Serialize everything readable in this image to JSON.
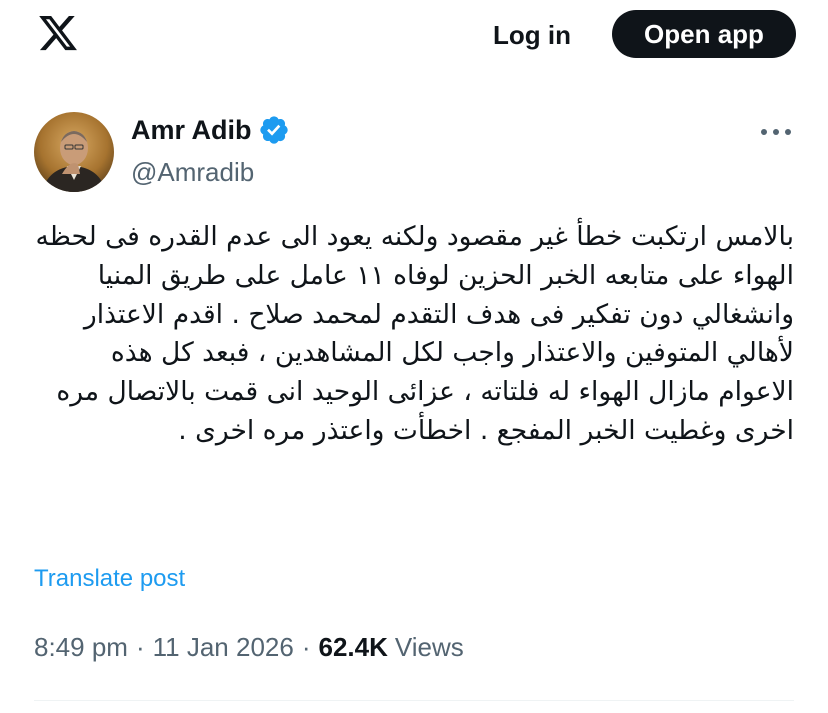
{
  "header": {
    "logo_icon": "x-logo-icon",
    "login_label": "Log in",
    "open_app_label": "Open app"
  },
  "author": {
    "name": "Amr Adib",
    "handle": "@Amradib",
    "verified": true,
    "verified_color": "#1d9bf0"
  },
  "post": {
    "text": "بالامس ارتكبت خطأ غير مقصود ولكنه يعود الى عدم القدره فى لحظه الهواء على متابعه الخبر الحزين لوفاه ١١ عامل على طريق المنيا وانشغالي دون تفكير فى هدف التقدم لمحمد صلاح . اقدم الاعتذار لأهالي المتوفين والاعتذار واجب لكل المشاهدين ، فبعد كل هذه الاعوام مازال الهواء له فلتاته ، عزائى الوحيد انى قمت بالاتصال مره اخرى وغطيت الخبر المفجع . اخطأت واعتذر مره اخرى .",
    "translate_label": "Translate post",
    "time": "8:49 pm",
    "separator": "·",
    "date": "11 Jan 2026",
    "views_count": "62.4K",
    "views_label": "Views"
  },
  "colors": {
    "accent": "#1d9bf0",
    "text": "#0f1419",
    "secondary": "#536471"
  }
}
